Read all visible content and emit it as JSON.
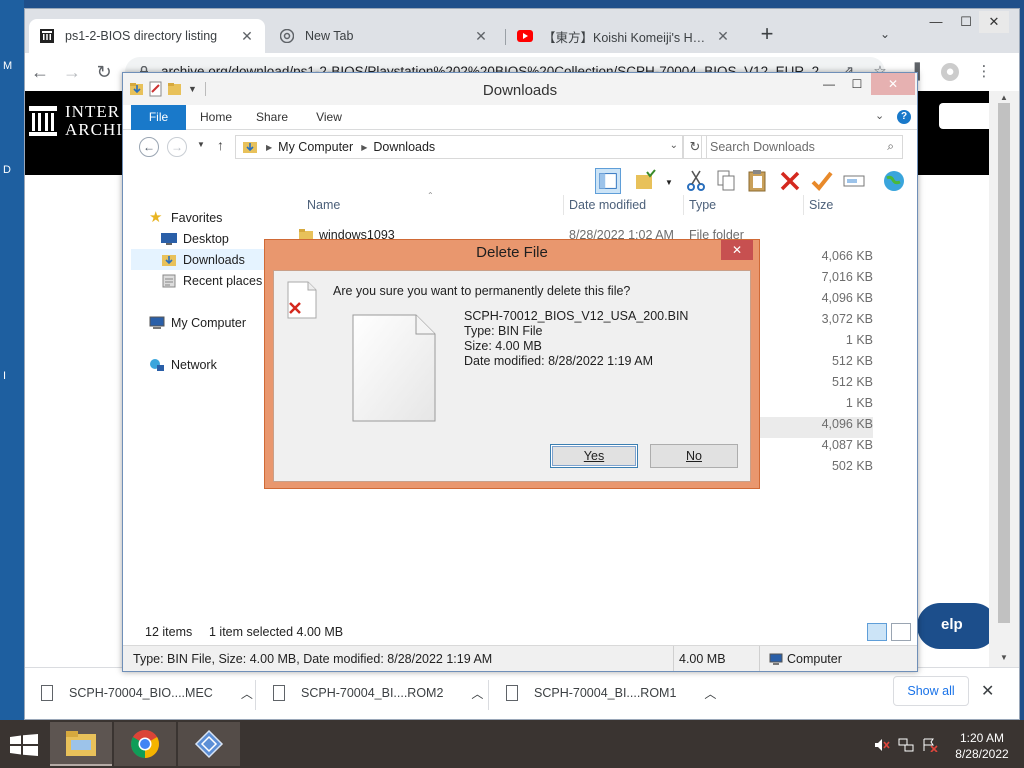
{
  "desktop": {
    "edge_letters": [
      "M",
      "D",
      "I"
    ]
  },
  "browser": {
    "tabs": [
      {
        "label": "ps1-2-BIOS directory listing",
        "active": true
      },
      {
        "label": "New Tab",
        "active": false
      },
      {
        "label": "【東方】Koishi Komeiji's Heart Th",
        "active": false
      }
    ],
    "window_controls": {
      "minimize": "—",
      "maximize": "☐",
      "close": "✕"
    },
    "url": "archive.org/download/ps1-2-BIOS/Playstation%202%20BIOS%20Collection/SCPH-70004_BIOS_V12_EUR_2",
    "page": {
      "logo_line1": "INTER",
      "logo_line2": "ARCHIV",
      "help_label": "elp"
    },
    "downloads_shelf": {
      "items": [
        {
          "name": "SCPH-70004_BIO....MEC"
        },
        {
          "name": "SCPH-70004_BI....ROM2"
        },
        {
          "name": "SCPH-70004_BI....ROM1"
        }
      ],
      "show_all": "Show all"
    }
  },
  "explorer": {
    "title": "Downloads",
    "ribbon_tabs": [
      "File",
      "Home",
      "Share",
      "View"
    ],
    "address": {
      "segments": [
        "My Computer",
        "Downloads"
      ]
    },
    "search_placeholder": "Search Downloads",
    "nav": {
      "favorites": "Favorites",
      "desktop": "Desktop",
      "downloads": "Downloads",
      "recent": "Recent places",
      "computer": "My Computer",
      "network": "Network"
    },
    "columns": {
      "name": "Name",
      "date": "Date modified",
      "type": "Type",
      "size": "Size"
    },
    "first_row": {
      "name": "windows1093",
      "date": "8/28/2022 1:02 AM",
      "type": "File folder"
    },
    "sizes": [
      "4,066 KB",
      "7,016 KB",
      "4,096 KB",
      "3,072 KB",
      "1 KB",
      "512 KB",
      "512 KB",
      "1 KB",
      "4,096 KB",
      "4,087 KB",
      "502 KB"
    ],
    "status": {
      "items": "12 items",
      "selected": "1 item selected  4.00 MB",
      "details": "Type: BIN File, Size: 4.00 MB, Date modified: 8/28/2022 1:19 AM",
      "size": "4.00 MB",
      "location": "Computer"
    }
  },
  "dialog": {
    "title": "Delete File",
    "question": "Are you sure you want to permanently delete this file?",
    "file_name": "SCPH-70012_BIOS_V12_USA_200.BIN",
    "file_type": "Type: BIN File",
    "file_size": "Size: 4.00 MB",
    "file_date": "Date modified: 8/28/2022 1:19 AM",
    "yes_label": "Yes",
    "no_label": "No"
  },
  "taskbar": {
    "time": "1:20 AM",
    "date": "8/28/2022"
  }
}
